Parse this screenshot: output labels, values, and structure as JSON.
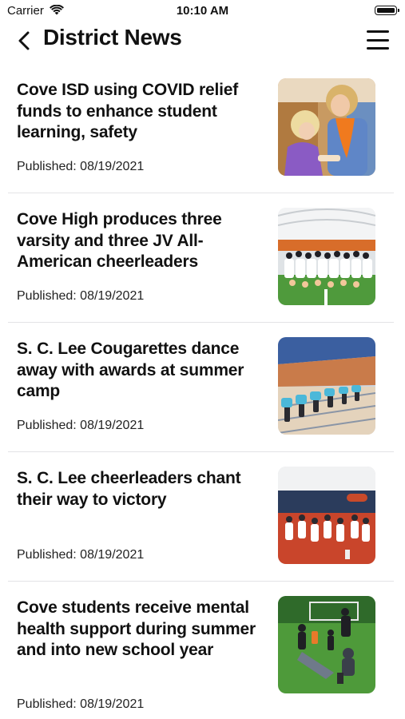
{
  "status_bar": {
    "carrier": "Carrier",
    "time": "10:10 AM"
  },
  "nav": {
    "title": "District News",
    "back_icon": "chevron-left-icon",
    "menu_icon": "hamburger-menu-icon"
  },
  "articles": [
    {
      "title": "Cove ISD using COVID relief funds to enhance student learning, safety",
      "published": "Published: 08/19/2021"
    },
    {
      "title": "Cove High produces three varsity and three JV All-American cheerleaders",
      "published": "Published: 08/19/2021"
    },
    {
      "title": "S. C. Lee Cougarettes dance away with awards at summer camp",
      "published": "Published: 08/19/2021"
    },
    {
      "title": "S. C. Lee cheerleaders chant their way to victory",
      "published": "Published: 08/19/2021"
    },
    {
      "title": "Cove students receive mental health support during summer and into new school year",
      "published": "Published: 08/19/2021"
    }
  ]
}
